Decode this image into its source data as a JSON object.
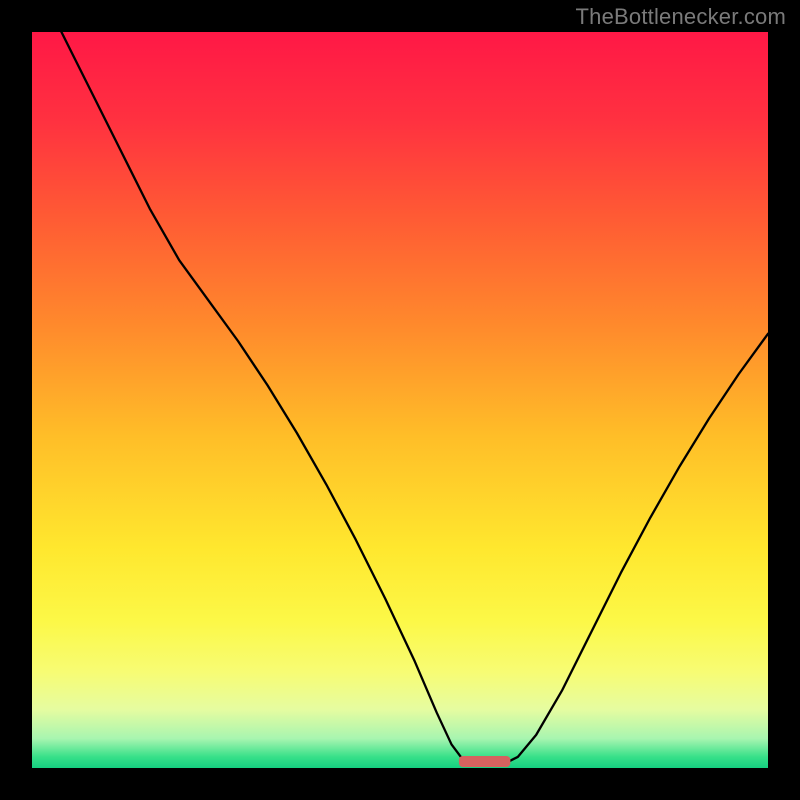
{
  "watermark": "TheBottlenecker.com",
  "chart_data": {
    "type": "line",
    "title": "",
    "xlabel": "",
    "ylabel": "",
    "xlim": [
      0,
      100
    ],
    "ylim": [
      0,
      100
    ],
    "background_gradient": [
      {
        "offset": 0.0,
        "color": "#ff1846"
      },
      {
        "offset": 0.12,
        "color": "#ff3140"
      },
      {
        "offset": 0.25,
        "color": "#ff5a34"
      },
      {
        "offset": 0.4,
        "color": "#ff8a2c"
      },
      {
        "offset": 0.55,
        "color": "#ffbe28"
      },
      {
        "offset": 0.7,
        "color": "#ffe72e"
      },
      {
        "offset": 0.8,
        "color": "#fcf847"
      },
      {
        "offset": 0.87,
        "color": "#f7fc74"
      },
      {
        "offset": 0.92,
        "color": "#e6fca0"
      },
      {
        "offset": 0.96,
        "color": "#a8f5b0"
      },
      {
        "offset": 0.985,
        "color": "#37e089"
      },
      {
        "offset": 1.0,
        "color": "#15cf80"
      }
    ],
    "series": [
      {
        "name": "bottleneck-curve",
        "stroke": "#000000",
        "stroke_width": 2.3,
        "points": [
          {
            "x": 4.0,
            "y": 100.0
          },
          {
            "x": 5.5,
            "y": 97.0
          },
          {
            "x": 8.0,
            "y": 92.0
          },
          {
            "x": 12.0,
            "y": 84.0
          },
          {
            "x": 16.0,
            "y": 76.0
          },
          {
            "x": 20.0,
            "y": 69.0
          },
          {
            "x": 24.0,
            "y": 63.5
          },
          {
            "x": 28.0,
            "y": 58.0
          },
          {
            "x": 32.0,
            "y": 52.0
          },
          {
            "x": 36.0,
            "y": 45.5
          },
          {
            "x": 40.0,
            "y": 38.5
          },
          {
            "x": 44.0,
            "y": 31.0
          },
          {
            "x": 48.0,
            "y": 23.0
          },
          {
            "x": 52.0,
            "y": 14.5
          },
          {
            "x": 55.0,
            "y": 7.5
          },
          {
            "x": 57.0,
            "y": 3.2
          },
          {
            "x": 58.5,
            "y": 1.2
          },
          {
            "x": 60.0,
            "y": 0.5
          },
          {
            "x": 62.0,
            "y": 0.5
          },
          {
            "x": 64.0,
            "y": 0.5
          },
          {
            "x": 66.0,
            "y": 1.5
          },
          {
            "x": 68.5,
            "y": 4.5
          },
          {
            "x": 72.0,
            "y": 10.5
          },
          {
            "x": 76.0,
            "y": 18.5
          },
          {
            "x": 80.0,
            "y": 26.5
          },
          {
            "x": 84.0,
            "y": 34.0
          },
          {
            "x": 88.0,
            "y": 41.0
          },
          {
            "x": 92.0,
            "y": 47.5
          },
          {
            "x": 96.0,
            "y": 53.5
          },
          {
            "x": 100.0,
            "y": 59.0
          }
        ]
      }
    ],
    "marker": {
      "name": "optimal-zone",
      "present": true,
      "x_center": 61.5,
      "width": 7.0,
      "fill": "#d6625f",
      "rx": 4
    }
  }
}
